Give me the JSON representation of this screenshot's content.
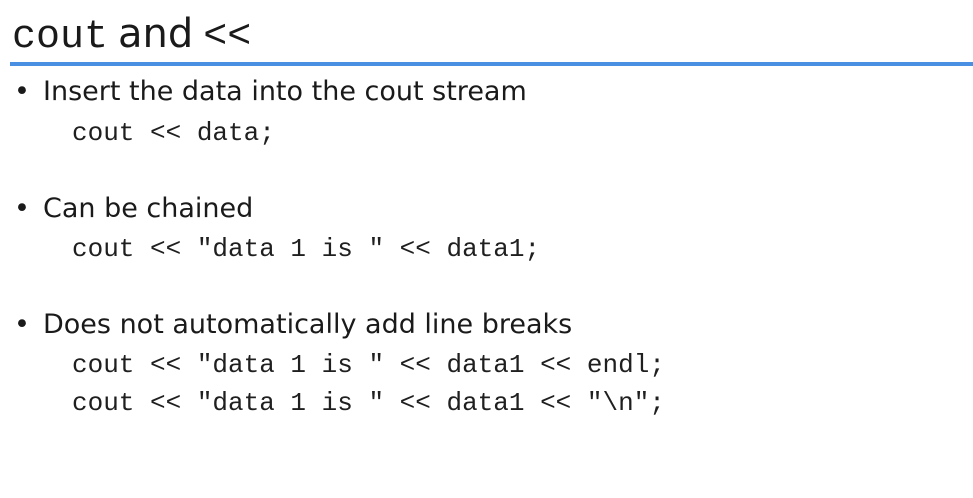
{
  "slide": {
    "title_code": "cout",
    "title_and": "and",
    "title_op": "<<",
    "accent_color": "#4a90e2",
    "bullet_glyph": "•",
    "items": [
      {
        "text": "Insert the data into the cout stream",
        "code": [
          "cout << data;"
        ]
      },
      {
        "text": "Can be chained",
        "code": [
          "cout << \"data 1 is \" << data1;"
        ]
      },
      {
        "text": "Does not automatically add line breaks",
        "code": [
          "cout << \"data 1 is \" << data1 << endl;",
          "cout << \"data 1 is \" << data1 << \"\\n\";"
        ]
      }
    ]
  }
}
